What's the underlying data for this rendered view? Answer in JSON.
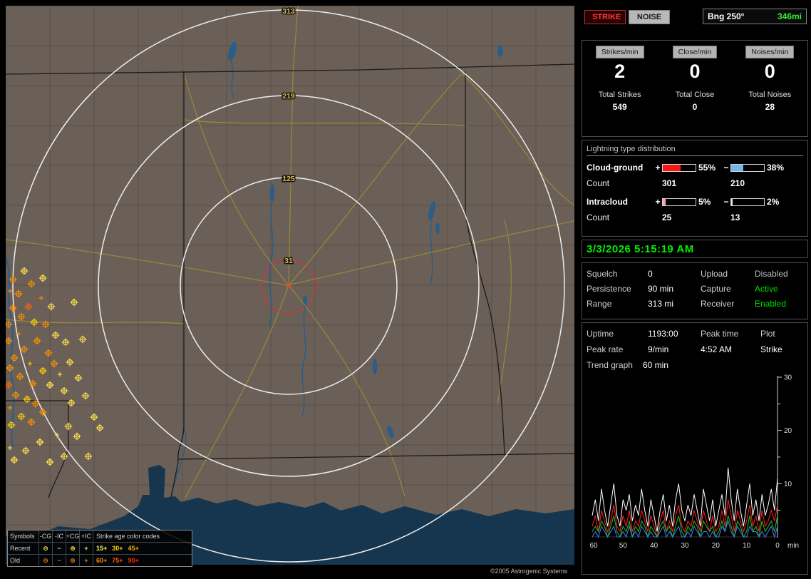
{
  "map": {
    "ring_labels": [
      "313",
      "219",
      "125",
      "31"
    ],
    "copyright": "©2005 Astrogenic Systems",
    "palette": {
      "y": "#ffe34d",
      "g": "#ffd400",
      "o": "#ff9100",
      "d": "#ff6a00"
    },
    "strikes": [
      [
        10,
        424,
        "o",
        0
      ],
      [
        22,
        436,
        "o",
        0
      ],
      [
        4,
        447,
        "o",
        0
      ],
      [
        32,
        422,
        "d",
        0
      ],
      [
        18,
        460,
        "o",
        1
      ],
      [
        40,
        444,
        "g",
        0
      ],
      [
        4,
        470,
        "o",
        0
      ],
      [
        26,
        482,
        "o",
        0
      ],
      [
        12,
        494,
        "o",
        0
      ],
      [
        44,
        470,
        "o",
        0
      ],
      [
        6,
        508,
        "o",
        0
      ],
      [
        34,
        502,
        "g",
        1
      ],
      [
        20,
        520,
        "o",
        0
      ],
      [
        4,
        532,
        "d",
        0
      ],
      [
        38,
        530,
        "o",
        0
      ],
      [
        52,
        512,
        "g",
        0
      ],
      [
        14,
        546,
        "o",
        0
      ],
      [
        30,
        552,
        "g",
        0
      ],
      [
        6,
        564,
        "o",
        1
      ],
      [
        42,
        558,
        "o",
        0
      ],
      [
        22,
        576,
        "g",
        0
      ],
      [
        8,
        588,
        "g",
        0
      ],
      [
        36,
        584,
        "o",
        0
      ],
      [
        52,
        570,
        "o",
        0
      ],
      [
        62,
        532,
        "y",
        0
      ],
      [
        68,
        502,
        "o",
        0
      ],
      [
        76,
        517,
        "y",
        1
      ],
      [
        60,
        487,
        "o",
        0
      ],
      [
        82,
        540,
        "y",
        0
      ],
      [
        92,
        557,
        "y",
        0
      ],
      [
        56,
        447,
        "o",
        0
      ],
      [
        70,
        462,
        "y",
        0
      ],
      [
        84,
        472,
        "y",
        0
      ],
      [
        50,
        410,
        "o",
        1
      ],
      [
        64,
        422,
        "y",
        0
      ],
      [
        18,
        404,
        "o",
        0
      ],
      [
        36,
        390,
        "o",
        0
      ],
      [
        52,
        382,
        "y",
        0
      ],
      [
        26,
        372,
        "y",
        0
      ],
      [
        10,
        384,
        "o",
        0
      ],
      [
        6,
        400,
        "o",
        1
      ],
      [
        90,
        500,
        "y",
        0
      ],
      [
        102,
        522,
        "y",
        0
      ],
      [
        112,
        547,
        "y",
        0
      ],
      [
        124,
        577,
        "y",
        0
      ],
      [
        88,
        590,
        "y",
        0
      ],
      [
        72,
        602,
        "y",
        1
      ],
      [
        48,
        612,
        "y",
        0
      ],
      [
        28,
        624,
        "y",
        0
      ],
      [
        12,
        637,
        "y",
        0
      ],
      [
        62,
        640,
        "y",
        0
      ],
      [
        100,
        604,
        "y",
        0
      ],
      [
        116,
        632,
        "y",
        0
      ],
      [
        82,
        632,
        "y",
        0
      ],
      [
        6,
        620,
        "y",
        1
      ],
      [
        132,
        592,
        "y",
        0
      ],
      [
        96,
        416,
        "y",
        0
      ],
      [
        108,
        468,
        "y",
        0
      ]
    ],
    "legend": {
      "symbols_title": "Symbols",
      "columns": [
        "-CG",
        "-IC",
        "+CG",
        "+IC"
      ],
      "age_title": "Strike age color codes",
      "recent_label": "Recent",
      "old_label": "Old",
      "symbol_glyphs": [
        "⊖",
        "−",
        "⊕",
        "+"
      ],
      "recent_color": "#ffe34d",
      "old_color": "#ff7a00",
      "recent_ages": [
        {
          "t": "15+",
          "c": "#ffff4d"
        },
        {
          "t": "30+",
          "c": "#ffd400"
        },
        {
          "t": "45+",
          "c": "#ffaa00"
        }
      ],
      "old_ages": [
        {
          "t": "60+",
          "c": "#ff8800"
        },
        {
          "t": "75+",
          "c": "#ff5500"
        },
        {
          "t": "90+",
          "c": "#ff2a00"
        }
      ]
    }
  },
  "topbar": {
    "strike": "STRIKE",
    "noise": "NOISE",
    "bearing_label": "Bng 250°",
    "bearing_value": "346mi"
  },
  "rates": {
    "columns": [
      {
        "header": "Strikes/min",
        "value": "2",
        "total_label": "Total Strikes",
        "total": "549"
      },
      {
        "header": "Close/min",
        "value": "0",
        "total_label": "Total Close",
        "total": "0"
      },
      {
        "header": "Noises/min",
        "value": "0",
        "total_label": "Total Noises",
        "total": "28"
      }
    ]
  },
  "distribution": {
    "title": "Lightning type distribution",
    "rows": [
      {
        "name": "Cloud-ground",
        "plus": "+",
        "minus": "−",
        "pos": {
          "w": 55,
          "c": "#ff1414"
        },
        "pos_pct": "55%",
        "neg": {
          "w": 38,
          "c": "#74b6e8"
        },
        "neg_pct": "38%",
        "count_label": "Count",
        "pos_count": "301",
        "neg_count": "210"
      },
      {
        "name": "Intracloud",
        "plus": "+",
        "minus": "−",
        "pos": {
          "w": 8,
          "c": "#ff9ad2"
        },
        "pos_pct": "5%",
        "neg": {
          "w": 4,
          "c": "#e8e8e8"
        },
        "neg_pct": "2%",
        "count_label": "Count",
        "pos_count": "25",
        "neg_count": "13"
      }
    ]
  },
  "datetime": "3/3/2026 5:15:19 AM",
  "settings": {
    "rows": [
      {
        "l1": "Squelch",
        "v1": "0",
        "l2": "Upload",
        "v2": "Disabled",
        "c2": "#bdbdbd"
      },
      {
        "l1": "Persistence",
        "v1": "90 min",
        "l2": "Capture",
        "v2": "Active",
        "c2": "#00dd00"
      },
      {
        "l1": "Range",
        "v1": "313 mi",
        "l2": "Receiver",
        "v2": "Enabled",
        "c2": "#00dd00"
      }
    ]
  },
  "stats": {
    "uptime_label": "Uptime",
    "uptime": "1193:00",
    "peaktime_label": "Peak time",
    "peaktime": "4:52 AM",
    "plot_label": "Plot",
    "plot": "Strike",
    "peakrate_label": "Peak rate",
    "peakrate": "9/min"
  },
  "trend": {
    "label": "Trend graph",
    "window": "60 min",
    "chart_data": {
      "type": "line",
      "ylim": [
        0,
        30
      ],
      "yticks": [
        10,
        20,
        30
      ],
      "xticks": [
        60,
        50,
        40,
        30,
        20,
        10,
        0
      ],
      "x_unit": "min",
      "series": [
        {
          "name": "total-strikes",
          "color": "#ffffff",
          "values": [
            4,
            7,
            3,
            9,
            5,
            2,
            6,
            10,
            4,
            2,
            7,
            5,
            8,
            3,
            6,
            4,
            9,
            5,
            2,
            7,
            4,
            1,
            5,
            8,
            3,
            6,
            2,
            7,
            10,
            5,
            3,
            6,
            4,
            8,
            5,
            2,
            9,
            6,
            3,
            7,
            2,
            5,
            8,
            4,
            13,
            7,
            3,
            9,
            5,
            2,
            6,
            10,
            4,
            7,
            3,
            8,
            4,
            6,
            9,
            5,
            11
          ]
        },
        {
          "name": "cloud-ground",
          "color": "#ff2020",
          "values": [
            2,
            4,
            1,
            5,
            3,
            1,
            3,
            6,
            2,
            1,
            4,
            2,
            5,
            1,
            3,
            2,
            5,
            3,
            1,
            4,
            2,
            0,
            3,
            5,
            1,
            3,
            1,
            4,
            6,
            2,
            1,
            3,
            2,
            5,
            3,
            1,
            5,
            3,
            1,
            4,
            1,
            2,
            5,
            2,
            7,
            4,
            1,
            5,
            3,
            1,
            3,
            6,
            2,
            4,
            1,
            5,
            2,
            3,
            5,
            3,
            6
          ]
        },
        {
          "name": "intracloud",
          "color": "#20c020",
          "values": [
            1,
            2,
            1,
            3,
            2,
            0,
            2,
            4,
            1,
            0,
            2,
            1,
            3,
            0,
            2,
            1,
            3,
            2,
            0,
            2,
            1,
            0,
            2,
            3,
            1,
            2,
            0,
            2,
            4,
            1,
            0,
            2,
            1,
            3,
            2,
            0,
            3,
            2,
            1,
            2,
            0,
            1,
            3,
            1,
            4,
            2,
            0,
            3,
            2,
            0,
            1,
            4,
            1,
            2,
            0,
            3,
            1,
            2,
            3,
            1,
            4
          ]
        },
        {
          "name": "noise",
          "color": "#4080ff",
          "values": [
            0,
            1,
            0,
            2,
            1,
            0,
            1,
            2,
            0,
            0,
            1,
            0,
            2,
            0,
            1,
            0,
            2,
            1,
            0,
            1,
            0,
            0,
            1,
            2,
            0,
            1,
            0,
            1,
            2,
            0,
            0,
            1,
            0,
            2,
            1,
            0,
            1,
            1,
            0,
            1,
            0,
            0,
            2,
            1,
            3,
            1,
            0,
            2,
            1,
            0,
            0,
            2,
            1,
            1,
            0,
            1,
            0,
            1,
            2,
            0,
            2
          ]
        }
      ]
    }
  }
}
